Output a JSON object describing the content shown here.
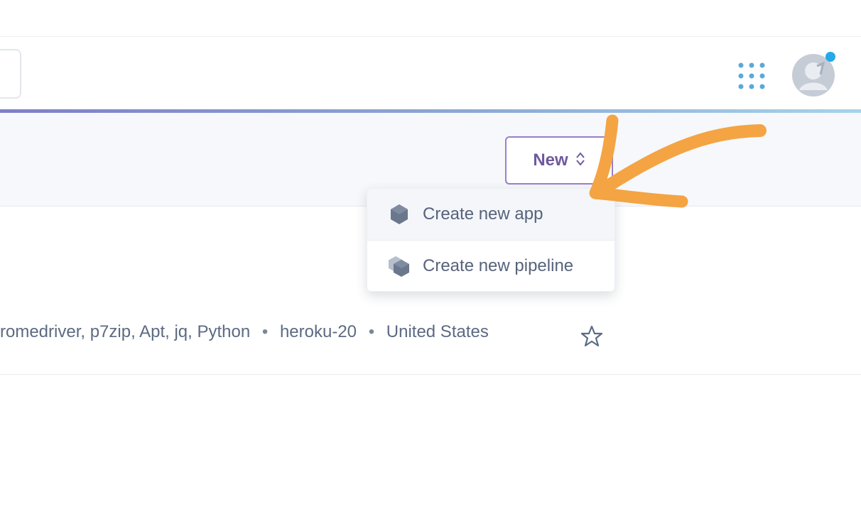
{
  "header": {
    "apps_icon": "apps-grid-icon",
    "avatar_icon": "avatar-icon",
    "notification_color": "#25a9e9"
  },
  "toolbar": {
    "new_label": "New",
    "new_icon": "chevron-updown-icon",
    "accent_color": "#9b7fc7"
  },
  "menu": {
    "items": [
      {
        "label": "Create new app",
        "icon": "hexagon-icon"
      },
      {
        "label": "Create new pipeline",
        "icon": "stacked-hexagon-icon"
      }
    ]
  },
  "app_row": {
    "buildpacks": "romedriver, p7zip, Apt, jq, Python",
    "stack": "heroku-20",
    "region": "United States",
    "separator": "•",
    "favorite_icon": "star-icon"
  },
  "annotation": {
    "type": "hand-drawn-arrow",
    "color": "#f4a443"
  }
}
